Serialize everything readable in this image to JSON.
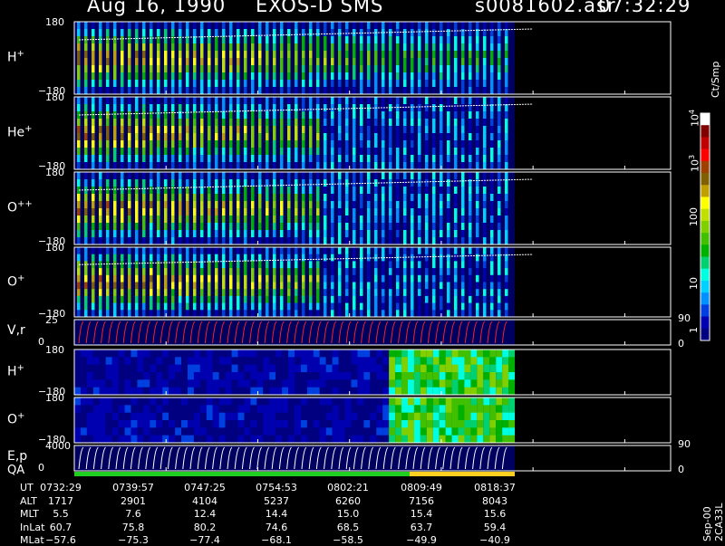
{
  "header": {
    "date": "Aug 16, 1990",
    "mission": "EXOS-D SMS",
    "file": "s0081602.asr",
    "time": "07:32:29"
  },
  "panels": [
    {
      "label": "H",
      "sup": "+",
      "top_tick": "180",
      "bottom_tick": "−180"
    },
    {
      "label": "He",
      "sup": "+",
      "top_tick": "180",
      "bottom_tick": "−180"
    },
    {
      "label": "O",
      "sup": "++",
      "top_tick": "180",
      "bottom_tick": "−180"
    },
    {
      "label": "O",
      "sup": "+",
      "top_tick": "180",
      "bottom_tick": "−180"
    },
    {
      "label": "V,r",
      "sup": "",
      "top_tick": "25",
      "bottom_tick": "0",
      "right_top": "90",
      "right_bottom": "0"
    },
    {
      "label": "H",
      "sup": "+",
      "top_tick": "180",
      "bottom_tick": "−180"
    },
    {
      "label": "O",
      "sup": "+",
      "top_tick": "180",
      "bottom_tick": "−180"
    },
    {
      "label": "E,p",
      "sup": "",
      "top_tick": "4000",
      "bottom_tick": "0",
      "right_top": "90",
      "right_bottom": "0"
    }
  ],
  "qa_label": "QA",
  "colorbar": {
    "title": "Ct/Smp",
    "ticks": [
      {
        "label": "1"
      },
      {
        "label": "10"
      },
      {
        "label": "100"
      },
      {
        "label": "10",
        "sup": "3"
      },
      {
        "label": "10",
        "sup": "4"
      }
    ],
    "colors": [
      "#000080",
      "#0000b0",
      "#0040e0",
      "#0090ff",
      "#00d0ff",
      "#00ffe0",
      "#00d070",
      "#00b000",
      "#40c000",
      "#80d000",
      "#c0e000",
      "#ffff00",
      "#c0a000",
      "#806000",
      "#a04000",
      "#ff0000",
      "#c00000",
      "#800000",
      "#ffffff"
    ]
  },
  "footer_note": "Sep-00  2CA33L",
  "ephemeris": {
    "rows": [
      "UT",
      "ALT",
      "MLT",
      "InLat",
      "MLat"
    ],
    "columns": [
      {
        "UT": "0732:29",
        "ALT": "1717",
        "MLT": "5.5",
        "InLat": "60.7",
        "MLat": "−57.6"
      },
      {
        "UT": "0739:57",
        "ALT": "2901",
        "MLT": "7.6",
        "InLat": "75.8",
        "MLat": "−75.3"
      },
      {
        "UT": "0747:25",
        "ALT": "4104",
        "MLT": "12.4",
        "InLat": "80.2",
        "MLat": "−77.4"
      },
      {
        "UT": "0754:53",
        "ALT": "5237",
        "MLT": "14.4",
        "InLat": "74.6",
        "MLat": "−68.1"
      },
      {
        "UT": "0802:21",
        "ALT": "6260",
        "MLT": "15.0",
        "InLat": "68.5",
        "MLat": "−58.5"
      },
      {
        "UT": "0809:49",
        "ALT": "7156",
        "MLT": "15.4",
        "InLat": "63.7",
        "MLat": "−49.9"
      },
      {
        "UT": "0818:37",
        "ALT": "8043",
        "MLT": "15.6",
        "InLat": "59.4",
        "MLat": "−40.9"
      }
    ]
  },
  "chart_data": {
    "type": "heatmap",
    "x": [
      "0732:29",
      "0739:57",
      "0747:25",
      "0754:53",
      "0802:21",
      "0809:49",
      "0818:37"
    ],
    "series": [
      {
        "name": "H+",
        "ylim": [
          -180,
          180
        ]
      },
      {
        "name": "He+",
        "ylim": [
          -180,
          180
        ]
      },
      {
        "name": "O++",
        "ylim": [
          -180,
          180
        ]
      },
      {
        "name": "O+",
        "ylim": [
          -180,
          180
        ]
      },
      {
        "name": "V,r",
        "ylim": [
          0,
          25
        ]
      },
      {
        "name": "H+",
        "ylim": [
          -180,
          180
        ]
      },
      {
        "name": "O+",
        "ylim": [
          -180,
          180
        ]
      },
      {
        "name": "E,p",
        "ylim": [
          0,
          4000
        ]
      }
    ],
    "colorscale": {
      "title": "Ct/Smp",
      "scale": "log",
      "range": [
        1,
        10000
      ]
    }
  }
}
